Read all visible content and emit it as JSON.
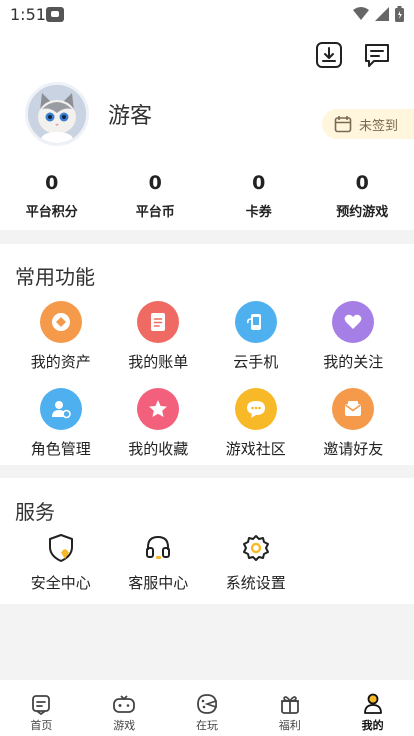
{
  "status_bar": {
    "time": "1:51"
  },
  "profile": {
    "username": "游客",
    "checkin_label": "未签到"
  },
  "stats": [
    {
      "value": "0",
      "label": "平台积分"
    },
    {
      "value": "0",
      "label": "平台币"
    },
    {
      "value": "0",
      "label": "卡券"
    },
    {
      "value": "0",
      "label": "预约游戏"
    }
  ],
  "features": {
    "title": "常用功能",
    "items": [
      {
        "label": "我的资产",
        "icon": "diamond-coin-icon",
        "color": "#f59a4a"
      },
      {
        "label": "我的账单",
        "icon": "bill-icon",
        "color": "#ef6a62"
      },
      {
        "label": "云手机",
        "icon": "cloud-phone-icon",
        "color": "#4fb0f0"
      },
      {
        "label": "我的关注",
        "icon": "heart-icon",
        "color": "#a57ee6"
      },
      {
        "label": "角色管理",
        "icon": "role-user-icon",
        "color": "#4fb0f0"
      },
      {
        "label": "我的收藏",
        "icon": "star-icon",
        "color": "#f2607c"
      },
      {
        "label": "游戏社区",
        "icon": "chat-bubble-icon",
        "color": "#f7b928"
      },
      {
        "label": "邀请好友",
        "icon": "envelope-icon",
        "color": "#f59a4a"
      }
    ]
  },
  "services": {
    "title": "服务",
    "items": [
      {
        "label": "安全中心",
        "icon": "shield-icon"
      },
      {
        "label": "客服中心",
        "icon": "headset-icon"
      },
      {
        "label": "系统设置",
        "icon": "gear-icon"
      }
    ]
  },
  "bottom_nav": [
    {
      "label": "首页",
      "icon": "home-document-icon",
      "active": false
    },
    {
      "label": "游戏",
      "icon": "gamepad-icon",
      "active": false
    },
    {
      "label": "在玩",
      "icon": "playing-icon",
      "active": false
    },
    {
      "label": "福利",
      "icon": "gift-icon",
      "active": false
    },
    {
      "label": "我的",
      "icon": "profile-icon",
      "active": true
    }
  ],
  "colors": {
    "accent": "#f7b928",
    "checkin_bg": "#fff6dd",
    "page_bg": "#f3f3f3"
  }
}
